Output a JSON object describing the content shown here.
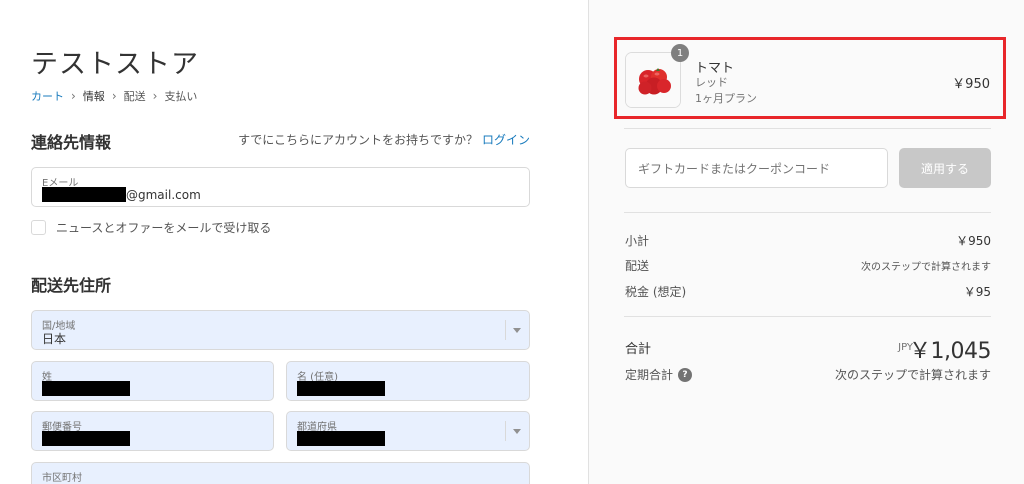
{
  "store": {
    "title": "テストストア"
  },
  "breadcrumb": {
    "items": [
      "カート",
      "情報",
      "配送",
      "支払い"
    ]
  },
  "contact": {
    "title": "連絡先情報",
    "account_prompt": "すでにこちらにアカウントをお持ちですか？",
    "login_link": "ログイン",
    "email_label": "Eメール",
    "email_suffix": "@gmail.com",
    "newsletter_label": "ニュースとオファーをメールで受け取る"
  },
  "shipping": {
    "title": "配送先住所",
    "country_label": "国/地域",
    "country_value": "日本",
    "last_name_label": "姓",
    "first_name_label": "名 (任意)",
    "postal_label": "郵便番号",
    "prefecture_label": "都道府県",
    "city_label": "市区町村"
  },
  "cart": {
    "item": {
      "quantity": "1",
      "name": "トマト",
      "variant": "レッド",
      "plan": "1ヶ月プラン",
      "price": "￥950"
    },
    "coupon_placeholder": "ギフトカードまたはクーポンコード",
    "apply_label": "適用する",
    "subtotal_label": "小計",
    "subtotal_value": "￥950",
    "shipping_label": "配送",
    "shipping_value": "次のステップで計算されます",
    "tax_label": "税金 (想定)",
    "tax_value": "￥95",
    "total_label": "合計",
    "total_currency": "JPY",
    "total_value": "￥1,045",
    "recurring_label": "定期合計",
    "recurring_value": "次のステップで計算されます"
  },
  "colors": {
    "link": "#197bbd",
    "highlight_border": "#e8262a",
    "autofill_bg": "#e8f0fe"
  },
  "icons": [
    "chevron-right-icon",
    "help-icon",
    "dropdown-arrow-icon",
    "product-image"
  ]
}
